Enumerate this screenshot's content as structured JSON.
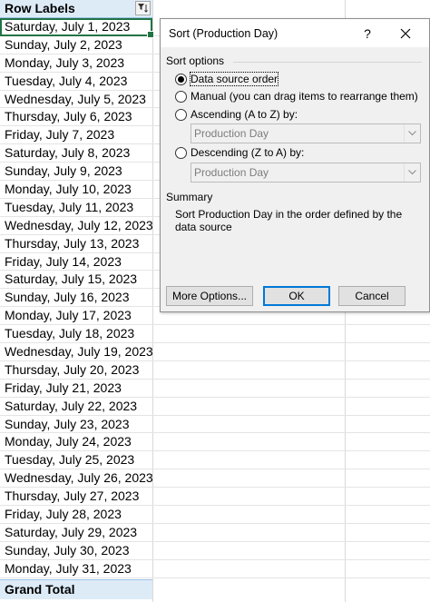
{
  "sheet": {
    "header_label": "Row Labels",
    "rows": [
      "Saturday, July 1, 2023",
      "Sunday, July 2, 2023",
      "Monday, July 3, 2023",
      "Tuesday, July 4, 2023",
      "Wednesday, July 5, 2023",
      "Thursday, July 6, 2023",
      "Friday, July 7, 2023",
      "Saturday, July 8, 2023",
      "Sunday, July 9, 2023",
      "Monday, July 10, 2023",
      "Tuesday, July 11, 2023",
      "Wednesday, July 12, 2023",
      "Thursday, July 13, 2023",
      "Friday, July 14, 2023",
      "Saturday, July 15, 2023",
      "Sunday, July 16, 2023",
      "Monday, July 17, 2023",
      "Tuesday, July 18, 2023",
      "Wednesday, July 19, 2023",
      "Thursday, July 20, 2023",
      "Friday, July 21, 2023",
      "Saturday, July 22, 2023",
      "Sunday, July 23, 2023",
      "Monday, July 24, 2023",
      "Tuesday, July 25, 2023",
      "Wednesday, July 26, 2023",
      "Thursday, July 27, 2023",
      "Friday, July 28, 2023",
      "Saturday, July 29, 2023",
      "Sunday, July 30, 2023",
      "Monday, July 31, 2023"
    ],
    "total_label": "Grand Total",
    "filter_icon": "filter-sort-icon",
    "colors": {
      "header_fill": "#ddebf7",
      "selection": "#217346"
    }
  },
  "dialog": {
    "title": "Sort (Production Day)",
    "help_label": "?",
    "close_icon": "close-icon",
    "sort_options_label": "Sort options",
    "options": [
      {
        "label": "Data source order",
        "checked": true
      },
      {
        "label": "Manual (you can drag items to rearrange them)",
        "checked": false
      },
      {
        "label": "Ascending (A to Z) by:",
        "checked": false
      },
      {
        "label": "Descending (Z to A) by:",
        "checked": false
      }
    ],
    "ascending_field": "Production Day",
    "descending_field": "Production Day",
    "summary_label": "Summary",
    "summary_text": "Sort Production Day in the order defined by the data source",
    "buttons": {
      "more_options": "More Options...",
      "ok": "OK",
      "cancel": "Cancel"
    },
    "colors": {
      "default_button_border": "#0078d7"
    }
  }
}
